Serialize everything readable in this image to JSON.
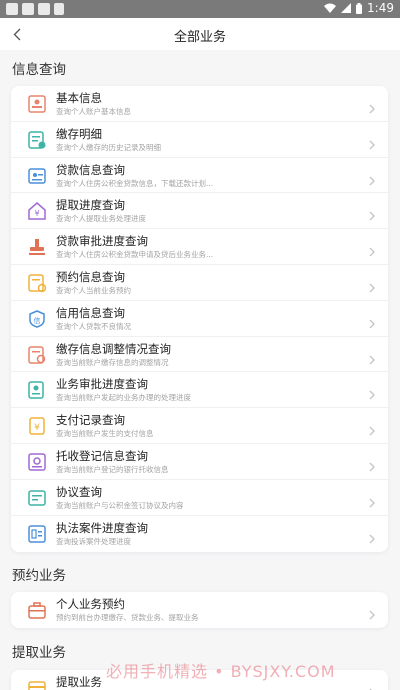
{
  "status_bar": {
    "time": "1:49"
  },
  "nav": {
    "title": "全部业务"
  },
  "sections": [
    {
      "title": "信息查询",
      "items": [
        {
          "title": "基本信息",
          "desc": "查询个人账户基本信息",
          "icon": "id-card-icon",
          "color": "#e8836c"
        },
        {
          "title": "缴存明细",
          "desc": "查询个人缴存的历史记录及明细",
          "icon": "deposit-list-icon",
          "color": "#3db4a6"
        },
        {
          "title": "贷款信息查询",
          "desc": "查询个人住房公积金贷款信息，下载还款计划...",
          "icon": "loan-info-icon",
          "color": "#4a8fd9"
        },
        {
          "title": "提取进度查询",
          "desc": "查询个人提取业务处理进度",
          "icon": "withdraw-progress-icon",
          "color": "#a06ad6"
        },
        {
          "title": "贷款审批进度查询",
          "desc": "查询个人住房公积金贷款申请及贷后业务业务...",
          "icon": "stamp-icon",
          "color": "#e07256"
        },
        {
          "title": "预约信息查询",
          "desc": "查询个人当前业务预约",
          "icon": "appointment-icon",
          "color": "#f0b23a"
        },
        {
          "title": "信用信息查询",
          "desc": "查询个人贷款不良情况",
          "icon": "credit-shield-icon",
          "color": "#4a8fd9"
        },
        {
          "title": "缴存信息调整情况查询",
          "desc": "查询当前账户缴存信息的调整情况",
          "icon": "deposit-adjust-icon",
          "color": "#e8836c"
        },
        {
          "title": "业务审批进度查询",
          "desc": "查询当前账户发起的业务办理的处理进度",
          "icon": "approval-progress-icon",
          "color": "#3db4a6"
        },
        {
          "title": "支付记录查询",
          "desc": "查询当前账户发生的支付信息",
          "icon": "payment-record-icon",
          "color": "#f0b23a"
        },
        {
          "title": "托收登记信息查询",
          "desc": "查询当前账户登记的银行托收信息",
          "icon": "collection-register-icon",
          "color": "#a06ad6"
        },
        {
          "title": "协议查询",
          "desc": "查询当前账户与公积金签订协议及内容",
          "icon": "agreement-icon",
          "color": "#3db4a6"
        },
        {
          "title": "执法案件进度查询",
          "desc": "查询投诉案件处理进度",
          "icon": "law-case-icon",
          "color": "#4a8fd9"
        }
      ]
    },
    {
      "title": "预约业务",
      "items": [
        {
          "title": "个人业务预约",
          "desc": "预约到前台办理缴存、贷款业务、提取业务",
          "icon": "briefcase-icon",
          "color": "#e07256"
        }
      ]
    },
    {
      "title": "提取业务",
      "items": [
        {
          "title": "提取业务",
          "desc": "",
          "icon": "withdraw-icon",
          "color": "#f0b23a"
        }
      ]
    }
  ],
  "watermark": "必用手机精选 • BYSJXY.COM"
}
